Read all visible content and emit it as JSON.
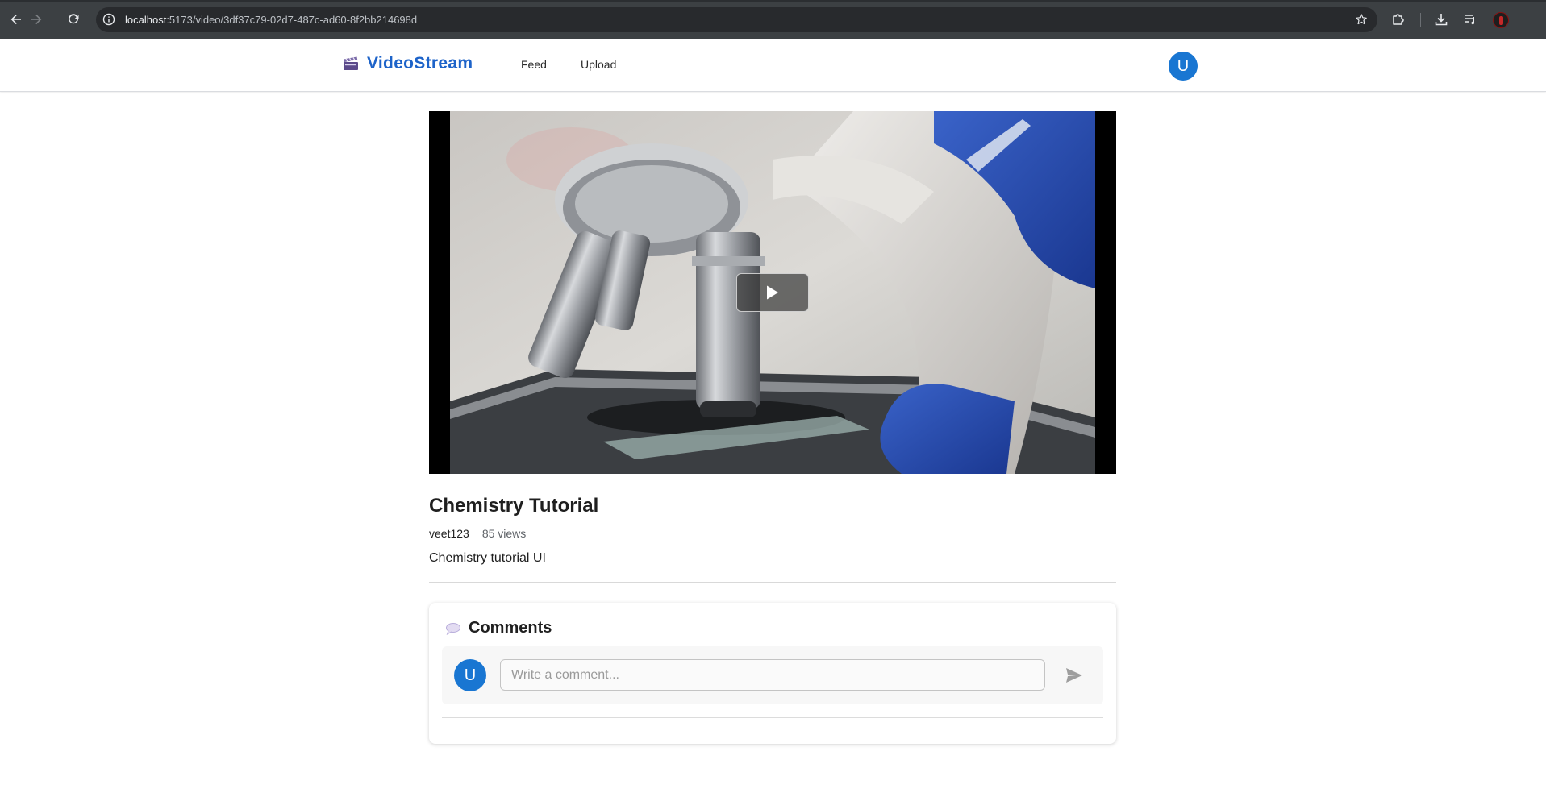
{
  "browser": {
    "url_host": "localhost",
    "url_path": ":5173/video/3df37c79-02d7-487c-ad60-8f2bb214698d",
    "icons": [
      "back-icon",
      "forward-icon",
      "reload-icon",
      "site-info-icon",
      "bookmark-star-icon",
      "extensions-icon",
      "downloads-icon",
      "media-controls-icon",
      "profile-avatar"
    ]
  },
  "header": {
    "logo_text": "VideoStream",
    "logo_icon": "clapperboard-icon",
    "nav": [
      {
        "label": "Feed"
      },
      {
        "label": "Upload"
      }
    ],
    "user_initial": "U"
  },
  "video": {
    "play_icon": "play-icon"
  },
  "info": {
    "title": "Chemistry Tutorial",
    "author": "veet123",
    "views": "85 views",
    "description": "Chemistry tutorial UI"
  },
  "comments": {
    "title": "Comments",
    "title_icon": "speech-bubble-icon",
    "user_initial": "U",
    "placeholder": "Write a comment...",
    "value": "",
    "send_icon": "send-icon"
  },
  "colors": {
    "brand": "#1d63c9",
    "avatar": "#1976d2",
    "chrome": "#3c4043",
    "omnibox": "#282a2d"
  }
}
